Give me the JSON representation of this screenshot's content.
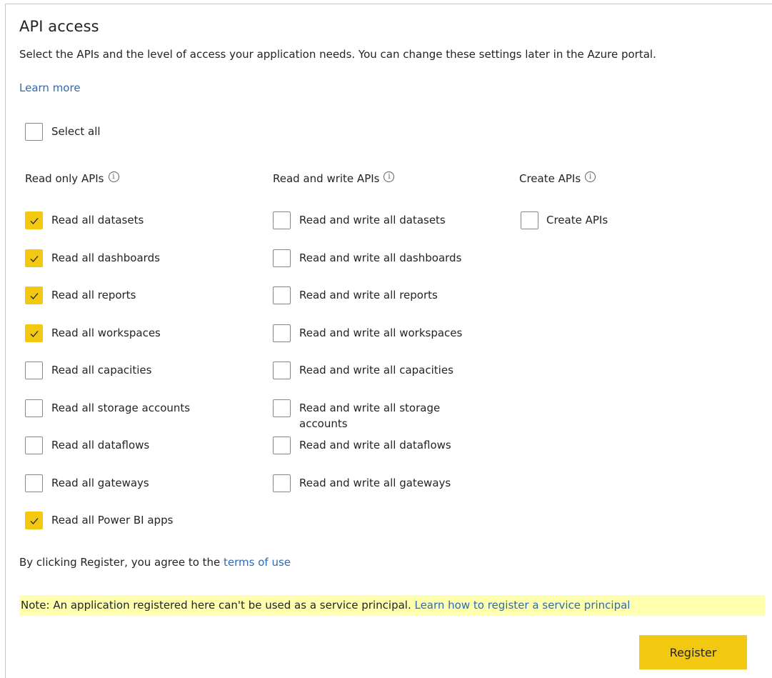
{
  "header": {
    "title": "API access",
    "description": "Select the APIs and the level of access your application needs. You can change these settings later in the Azure portal.",
    "learn_more": "Learn more"
  },
  "select_all": {
    "label": "Select all",
    "checked": false
  },
  "columns": {
    "read_only": {
      "heading": "Read only APIs",
      "items": [
        {
          "label": "Read all datasets",
          "checked": true
        },
        {
          "label": "Read all dashboards",
          "checked": true
        },
        {
          "label": "Read all reports",
          "checked": true
        },
        {
          "label": "Read all workspaces",
          "checked": true
        },
        {
          "label": "Read all capacities",
          "checked": false
        },
        {
          "label": "Read all storage accounts",
          "checked": false
        },
        {
          "label": "Read all dataflows",
          "checked": false
        },
        {
          "label": "Read all gateways",
          "checked": false
        },
        {
          "label": "Read all Power BI apps",
          "checked": true
        }
      ]
    },
    "read_write": {
      "heading": "Read and write APIs",
      "items": [
        {
          "label": "Read and write all datasets",
          "checked": false
        },
        {
          "label": "Read and write all dashboards",
          "checked": false
        },
        {
          "label": "Read and write all reports",
          "checked": false
        },
        {
          "label": "Read and write all workspaces",
          "checked": false
        },
        {
          "label": "Read and write all capacities",
          "checked": false
        },
        {
          "label": "Read and write all storage",
          "label_line2": "accounts",
          "checked": false
        },
        {
          "label": "Read and write all dataflows",
          "checked": false
        },
        {
          "label": "Read and write all gateways",
          "checked": false
        }
      ]
    },
    "create": {
      "heading": "Create APIs",
      "items": [
        {
          "label": "Create APIs",
          "checked": false
        }
      ]
    }
  },
  "info_icon": "info-icon",
  "terms": {
    "prefix": "By clicking Register, you agree to the ",
    "link": "terms of use"
  },
  "note": {
    "text": "Note: An application registered here can't be used as a service principal. ",
    "link": "Learn how to register a service principal"
  },
  "register_button": "Register",
  "colors": {
    "accent": "#f2c811",
    "link": "#2b6bb3",
    "note_bg": "#ffffb0"
  }
}
